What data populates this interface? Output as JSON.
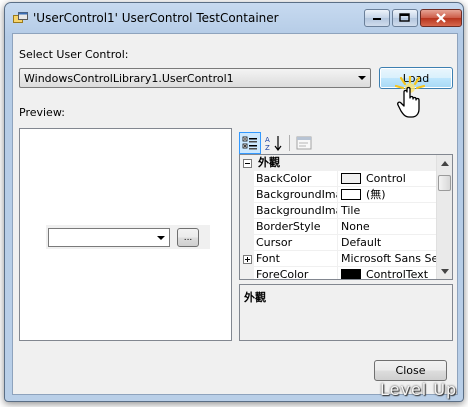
{
  "window": {
    "title": "'UserControl1' UserControl TestContainer",
    "icons": {
      "app": "app-window-icon",
      "minimize": "minimize-icon",
      "maximize": "maximize-icon",
      "close": "close-icon"
    }
  },
  "select": {
    "label": "Select User Control:",
    "value": "WindowsControlLibrary1.UserControl1",
    "load_button": "Load"
  },
  "preview": {
    "label": "Preview:",
    "browse_button": "..."
  },
  "property_grid": {
    "toolbar": [
      "categorized-icon",
      "alphabetical-icon",
      "property-pages-icon"
    ],
    "category": "外觀",
    "rows": [
      {
        "name": "BackColor",
        "value": "Control",
        "swatch": "#f0f0f0"
      },
      {
        "name": "BackgroundImage",
        "value": "(無)",
        "swatch": "#ffffff"
      },
      {
        "name": "BackgroundImageLayout",
        "value": "Tile"
      },
      {
        "name": "BorderStyle",
        "value": "None"
      },
      {
        "name": "Cursor",
        "value": "Default"
      },
      {
        "name": "Font",
        "value": "Microsoft Sans Serif",
        "expandable": true
      },
      {
        "name": "ForeColor",
        "value": "ControlText",
        "swatch": "#000000"
      }
    ],
    "description_title": "外觀"
  },
  "footer": {
    "close_button": "Close"
  },
  "watermark": "Level Up",
  "colors": {
    "accent": "#3399ff",
    "titlebar": "#c7daf0",
    "close": "#c8482f"
  }
}
